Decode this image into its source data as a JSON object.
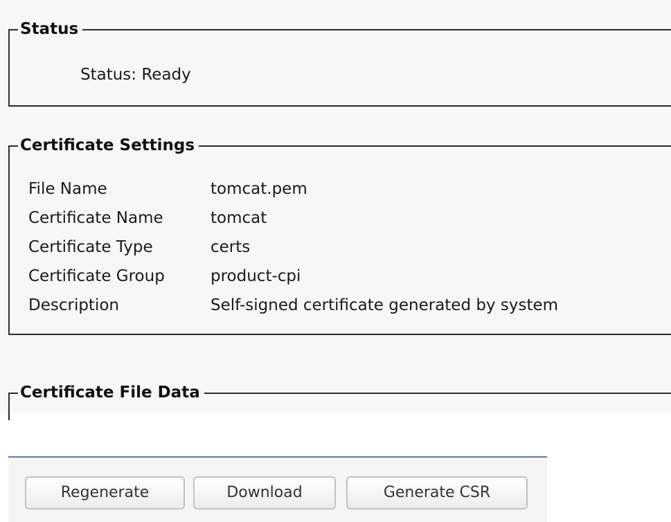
{
  "status_section": {
    "legend": "Status",
    "status_text": "Status: Ready"
  },
  "settings_section": {
    "legend": "Certificate Settings",
    "rows": [
      {
        "label": "File Name",
        "value": "tomcat.pem"
      },
      {
        "label": "Certificate Name",
        "value": "tomcat"
      },
      {
        "label": "Certificate Type",
        "value": "certs"
      },
      {
        "label": "Certificate Group",
        "value": "product-cpi"
      },
      {
        "label": "Description",
        "value": "Self-signed certificate generated by system"
      }
    ]
  },
  "file_data_section": {
    "legend": "Certificate File Data"
  },
  "buttons": {
    "regenerate": "Regenerate",
    "download": "Download",
    "generate_csr": "Generate CSR"
  }
}
